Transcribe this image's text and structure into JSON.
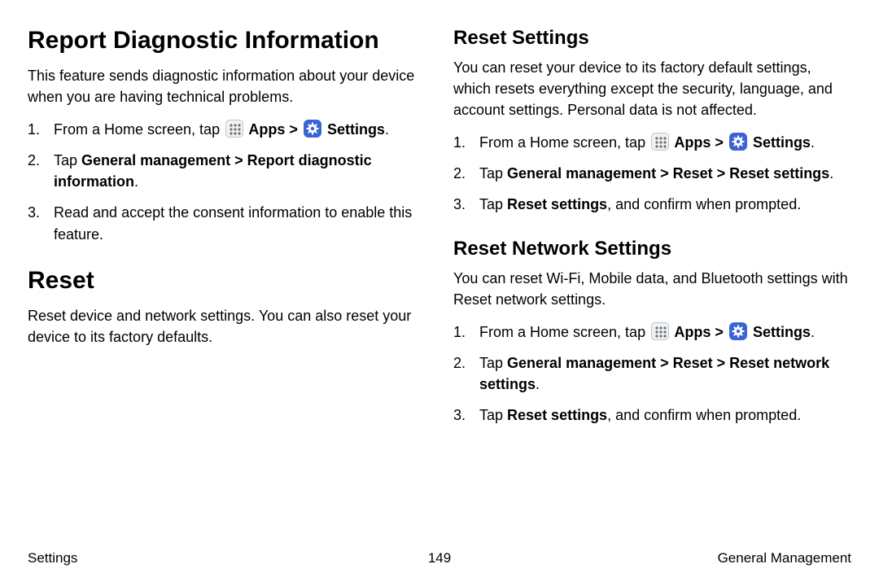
{
  "icons": {
    "apps": "Apps",
    "settings": "Settings"
  },
  "col1": {
    "section1": {
      "heading": "Report Diagnostic Information",
      "desc": "This feature sends diagnostic information about your device when you are having technical problems.",
      "steps": [
        {
          "runs": [
            {
              "t": "From a Home screen, tap "
            },
            {
              "icon": "apps"
            },
            {
              "t": " Apps",
              "b": true
            },
            {
              "t": " > ",
              "b": true
            },
            {
              "icon": "settings"
            },
            {
              "t": " Settings",
              "b": true
            },
            {
              "t": "."
            }
          ]
        },
        {
          "runs": [
            {
              "t": "Tap "
            },
            {
              "t": "General management > Report diagnostic information",
              "b": true
            },
            {
              "t": "."
            }
          ]
        },
        {
          "runs": [
            {
              "t": "Read and accept the consent information to enable this feature."
            }
          ]
        }
      ]
    },
    "section2": {
      "heading": "Reset",
      "desc": "Reset device and network settings. You can also reset your device to its factory defaults."
    }
  },
  "col2": {
    "section1": {
      "heading": "Reset Settings",
      "desc": "You can reset your device to its factory default settings, which resets everything except the security, language, and account settings. Personal data is not affected.",
      "steps": [
        {
          "runs": [
            {
              "t": "From a Home screen, tap "
            },
            {
              "icon": "apps"
            },
            {
              "t": " Apps",
              "b": true
            },
            {
              "t": " > ",
              "b": true
            },
            {
              "icon": "settings"
            },
            {
              "t": " Settings",
              "b": true
            },
            {
              "t": "."
            }
          ]
        },
        {
          "runs": [
            {
              "t": "Tap "
            },
            {
              "t": "General management > Reset > Reset settings",
              "b": true
            },
            {
              "t": "."
            }
          ]
        },
        {
          "runs": [
            {
              "t": "Tap "
            },
            {
              "t": "Reset settings",
              "b": true
            },
            {
              "t": ", and confirm when prompted."
            }
          ]
        }
      ]
    },
    "section2": {
      "heading": "Reset Network Settings",
      "desc": "You can reset Wi-Fi, Mobile data, and Bluetooth settings with Reset network settings.",
      "steps": [
        {
          "runs": [
            {
              "t": "From a Home screen, tap "
            },
            {
              "icon": "apps"
            },
            {
              "t": " Apps",
              "b": true
            },
            {
              "t": " > ",
              "b": true
            },
            {
              "icon": "settings"
            },
            {
              "t": " Settings",
              "b": true
            },
            {
              "t": "."
            }
          ]
        },
        {
          "runs": [
            {
              "t": "Tap "
            },
            {
              "t": "General management > Reset > Reset network settings",
              "b": true
            },
            {
              "t": "."
            }
          ]
        },
        {
          "runs": [
            {
              "t": "Tap "
            },
            {
              "t": "Reset settings",
              "b": true
            },
            {
              "t": ", and confirm when prompted."
            }
          ]
        }
      ]
    }
  },
  "footer": {
    "left": "Settings",
    "center": "149",
    "right": "General Management"
  }
}
